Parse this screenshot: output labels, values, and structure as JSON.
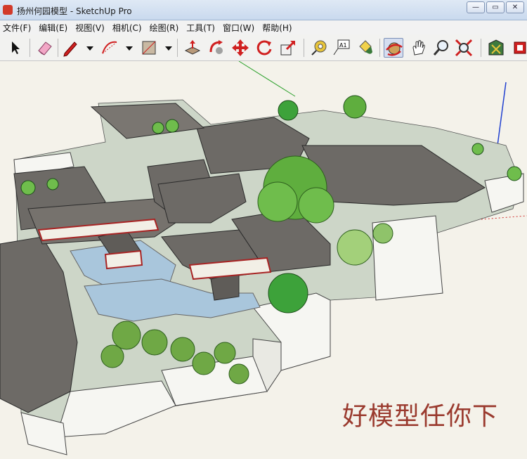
{
  "window": {
    "title": "扬州何园模型 - SketchUp Pro",
    "buttons": {
      "minimize": "—",
      "maximize": "▭",
      "close": "✕"
    }
  },
  "menu": {
    "items": [
      {
        "label": "文件(F)"
      },
      {
        "label": "编辑(E)"
      },
      {
        "label": "视图(V)"
      },
      {
        "label": "相机(C)"
      },
      {
        "label": "绘图(R)"
      },
      {
        "label": "工具(T)"
      },
      {
        "label": "窗口(W)"
      },
      {
        "label": "帮助(H)"
      }
    ]
  },
  "toolbar": {
    "tools": [
      "select-icon",
      "eraser-icon",
      "pencil-icon",
      "dropdown-arrow-icon",
      "arc-icon",
      "dropdown-arrow-icon",
      "rectangle-icon",
      "dropdown-arrow-icon",
      "push-pull-icon",
      "follow-me-icon",
      "move-icon",
      "rotate-icon",
      "scale-icon",
      "tape-measure-icon",
      "text-icon",
      "paint-bucket-icon",
      "orbit-icon",
      "pan-icon",
      "zoom-icon",
      "zoom-extents-icon",
      "warehouse-icon",
      "extension-icon"
    ],
    "active_tool": "orbit-icon"
  },
  "viewport": {
    "caption": "好模型任你下",
    "axis_colors": {
      "red": "#d03030",
      "green": "#2aa02a",
      "blue": "#2040d0"
    },
    "palette": {
      "roof": "#6d6a66",
      "wall": "#f6f6f2",
      "water": "#a9c6dc",
      "ground": "#c9d3c4",
      "tree": "#5fae3e",
      "timber": "#a82424"
    }
  }
}
